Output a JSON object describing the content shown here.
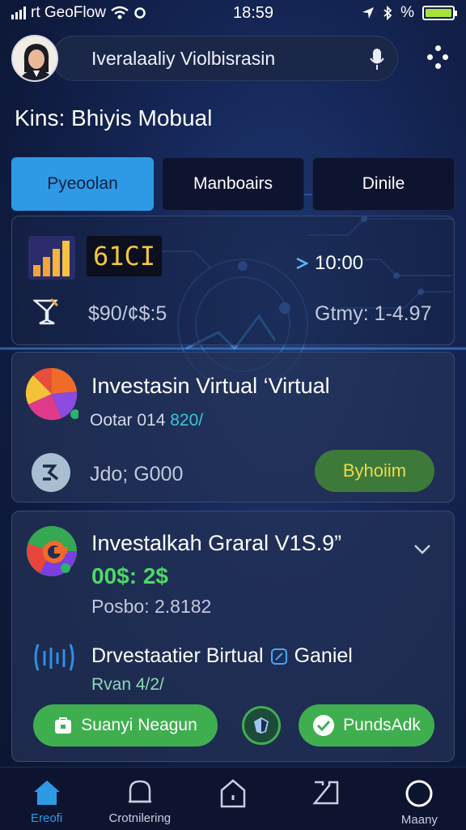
{
  "status_bar": {
    "carrier": "rt GeoFlow",
    "time": "18:59",
    "battery_label": "%"
  },
  "search": {
    "value": "Iveralaaliy Violbisrasin"
  },
  "page_heading": "Kins: Bhiyis Mobual",
  "tabs": [
    {
      "label": "Pyeoolan",
      "active": true
    },
    {
      "label": "Manboairs",
      "active": false
    },
    {
      "label": "Dinile",
      "active": false
    }
  ],
  "summary_card": {
    "value_display": "61CI",
    "time": "10:00",
    "amount": "$90/¢$:5",
    "right_value": "Gtmy: 1-4.97"
  },
  "investment_card_1": {
    "title": "Investasin Virtual ‘Virtual",
    "subtitle_prefix": "Ootar 014 ",
    "subtitle_highlight": "820/",
    "amount": "Jdo; G000",
    "button_label": "Byhoiim"
  },
  "investment_card_2": {
    "title": "Investalkah Graral V1S.9”",
    "green_value": "00$: 2$",
    "position": "Posbo: 2.8182",
    "feature_title_a": "Drvestaatier Birtual",
    "feature_title_b": "Ganiel",
    "feature_sub": "Rvan 4/2/",
    "btn_left_label": "Suanyi Neagun",
    "btn_right_label": "PundsAdk"
  },
  "bottom_nav": [
    {
      "label": "Ereofi",
      "icon": "home-icon",
      "active": true
    },
    {
      "label": "Crotnilering",
      "icon": "bell-icon",
      "active": false
    },
    {
      "label": "",
      "icon": "house-outline-icon",
      "active": false
    },
    {
      "label": "",
      "icon": "bracket-square-icon",
      "active": false
    },
    {
      "label": "Maany",
      "icon": "circle-icon",
      "active": false
    }
  ],
  "colors": {
    "accent": "#2e9ae6",
    "success": "#3fae4f",
    "gold": "#f4c542",
    "background": "#16285a"
  }
}
